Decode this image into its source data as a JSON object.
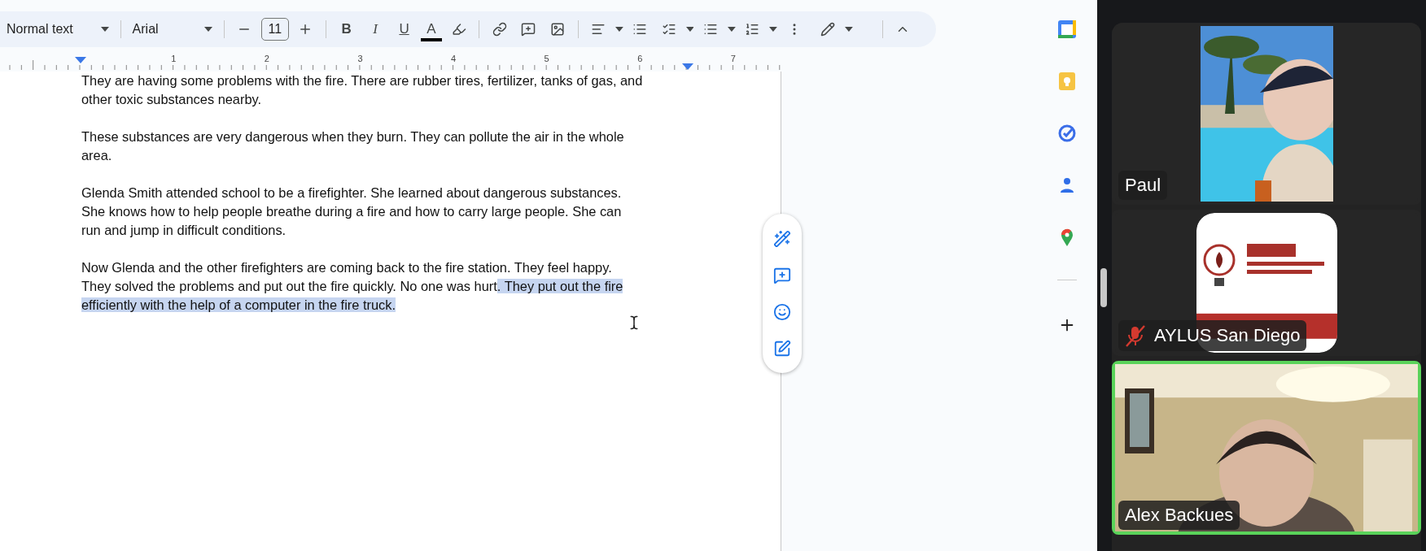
{
  "toolbar": {
    "style": "Normal text",
    "font": "Arial",
    "font_size": "11",
    "bold": "B",
    "italic": "I",
    "underline": "U",
    "text_color": "A"
  },
  "ruler": {
    "labels": [
      "1",
      "2",
      "3",
      "4",
      "5",
      "6",
      "7"
    ]
  },
  "document": {
    "paragraphs": [
      {
        "text": "They are having some problems with the fire. There are rubber tires, fertilizer, tanks of gas, and other toxic substances nearby."
      },
      {
        "text": "These substances are very dangerous when they burn. They can pollute the air in the whole area."
      },
      {
        "text": "Glenda Smith attended school to be a firefighter. She learned about dangerous substances. She knows how to help people breathe during a fire and how to carry large people. She can run and jump in difficult conditions."
      },
      {
        "text": "Now Glenda and the other firefighters are coming back to the fire station. They feel happy. They solved the problems and put out the fire quickly. No one was hurt",
        "selection": ". They put out the fire efficiently with the help of a computer in the fire truck. "
      }
    ]
  },
  "participants": [
    {
      "name": "Paul",
      "kind": "pool",
      "muted": false,
      "speaking": false
    },
    {
      "name": "AYLUS San Diego",
      "kind": "logo",
      "muted": true,
      "speaking": false
    },
    {
      "name": "Alex Backues",
      "kind": "room",
      "muted": false,
      "speaking": true
    }
  ]
}
